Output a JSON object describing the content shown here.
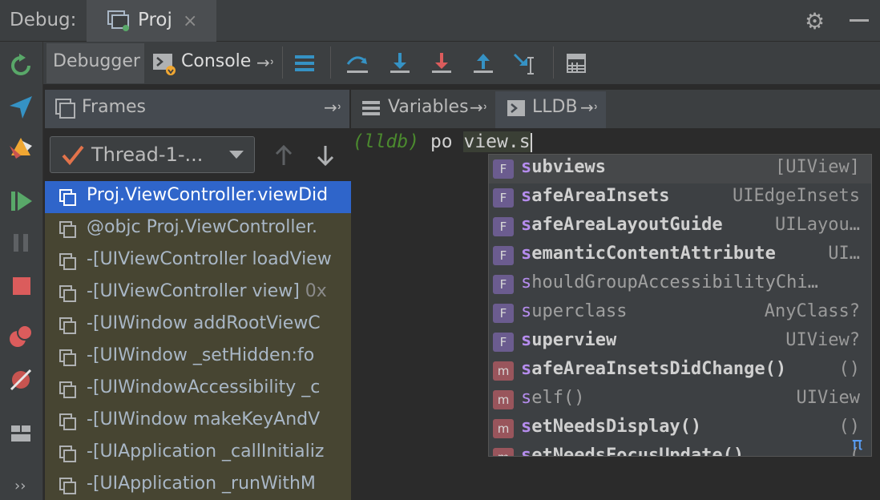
{
  "topbar": {
    "debug_label": "Debug:",
    "tab_label": "Proj",
    "close": "×"
  },
  "toolbar": {
    "debugger_tab": "Debugger",
    "console_tab": "Console"
  },
  "frames": {
    "title": "Frames",
    "thread": "Thread-1-...",
    "items": [
      {
        "text": "Proj.ViewController.viewDid",
        "sub": ""
      },
      {
        "text": "@objc Proj.ViewController.",
        "sub": ""
      },
      {
        "text": "-[UIViewController loadView",
        "sub": ""
      },
      {
        "text": "-[UIViewController view] ",
        "sub": "0x"
      },
      {
        "text": "-[UIWindow addRootViewC",
        "sub": ""
      },
      {
        "text": "-[UIWindow _setHidden:fo",
        "sub": ""
      },
      {
        "text": "-[UIWindowAccessibility _c",
        "sub": ""
      },
      {
        "text": "-[UIWindow makeKeyAndV",
        "sub": ""
      },
      {
        "text": "-[UIApplication _callInitializ",
        "sub": ""
      },
      {
        "text": "-[UIApplication _runWithM",
        "sub": ""
      }
    ]
  },
  "variables": {
    "title": "Variables"
  },
  "lldb": {
    "tab_label": "LLDB",
    "prompt": "(lldb)",
    "command": " po ",
    "input": "view.s"
  },
  "completions": [
    {
      "kind": "F",
      "match": "s",
      "rest": "ubviews",
      "type": "[UIView]",
      "bold": true
    },
    {
      "kind": "F",
      "match": "s",
      "rest": "afeAreaInsets",
      "type": "UIEdgeInsets",
      "bold": true
    },
    {
      "kind": "F",
      "match": "s",
      "rest": "afeAreaLayoutGuide",
      "type": "UILayou…",
      "bold": true
    },
    {
      "kind": "F",
      "match": "s",
      "rest": "emanticContentAttribute",
      "type": "UI…",
      "bold": true
    },
    {
      "kind": "F",
      "match": "s",
      "rest": "houldGroupAccessibilityChi…",
      "type": "",
      "bold": false
    },
    {
      "kind": "F",
      "match": "s",
      "rest": "uperclass",
      "type": "AnyClass?",
      "bold": false
    },
    {
      "kind": "F",
      "match": "s",
      "rest": "uperview",
      "type": "UIView?",
      "bold": true
    },
    {
      "kind": "m",
      "match": "s",
      "rest": "afeAreaInsetsDidChange()",
      "type": "()",
      "bold": true
    },
    {
      "kind": "m",
      "match": "s",
      "rest": "elf()",
      "type": "UIView",
      "bold": false
    },
    {
      "kind": "m",
      "match": "s",
      "rest": "etNeedsDisplay()",
      "type": "()",
      "bold": true
    },
    {
      "kind": "m",
      "match": "s",
      "rest": "etNeedsFocusUpdate()",
      "type": "(",
      "bold": true
    }
  ],
  "popup_footer": "π",
  "colors": {
    "selection": "#2f65ca",
    "frame_bg": "#474532",
    "accent_green": "#499c54"
  }
}
